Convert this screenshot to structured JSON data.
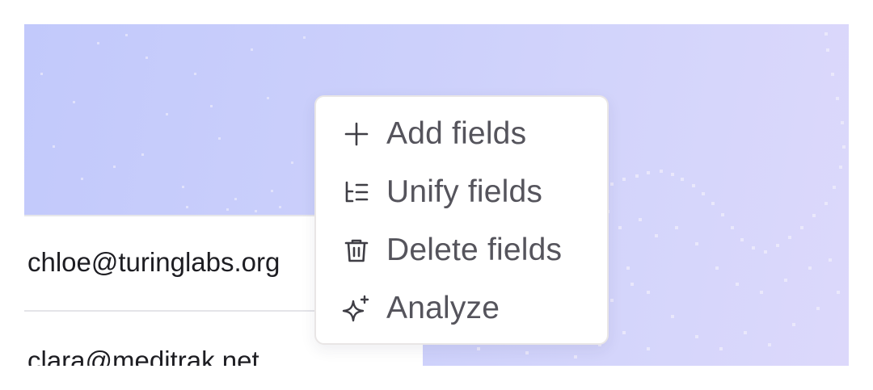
{
  "context_menu": {
    "items": [
      {
        "label": "Add fields",
        "icon": "plus-icon"
      },
      {
        "label": "Unify fields",
        "icon": "unify-list-icon"
      },
      {
        "label": "Delete fields",
        "icon": "trash-icon"
      },
      {
        "label": "Analyze",
        "icon": "sparkle-icon"
      }
    ]
  },
  "table": {
    "rows": [
      {
        "email": "chloe@turinglabs.org"
      },
      {
        "email": "clara@meditrak.net"
      }
    ]
  },
  "colors": {
    "background_start": "#c2c9fb",
    "background_end": "#dcd8fb",
    "menu_text": "#55545c",
    "row_text": "#1d1d22"
  }
}
